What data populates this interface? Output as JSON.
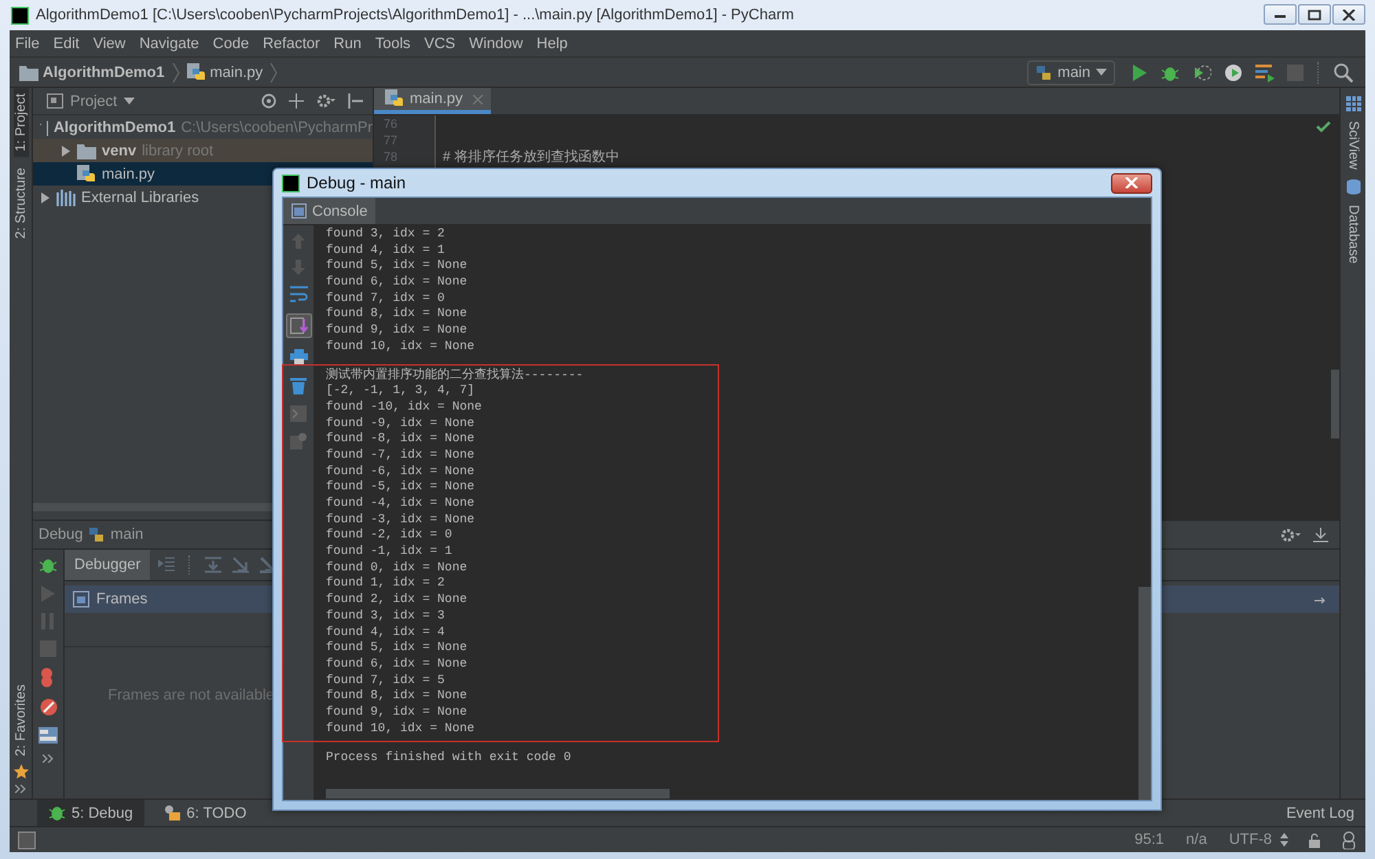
{
  "window": {
    "title": "AlgorithmDemo1 [C:\\Users\\cooben\\PycharmProjects\\AlgorithmDemo1] - ...\\main.py [AlgorithmDemo1] - PyCharm"
  },
  "menu": [
    "File",
    "Edit",
    "View",
    "Navigate",
    "Code",
    "Refactor",
    "Run",
    "Tools",
    "VCS",
    "Window",
    "Help"
  ],
  "breadcrumb": [
    "AlgorithmDemo1",
    "main.py"
  ],
  "run_config": "main",
  "left_strip": [
    {
      "label": "1: Project",
      "selected": true
    },
    {
      "label": "2: Structure",
      "selected": false
    }
  ],
  "favorites": "2: Favorites",
  "project": {
    "title": "Project",
    "tree": [
      {
        "name": "AlgorithmDemo1",
        "hint": "C:\\Users\\cooben\\PycharmPr",
        "kind": "folder",
        "expanded": true,
        "selected": false,
        "children": [
          {
            "name": "venv",
            "hint": "library root",
            "kind": "library-folder",
            "expanded": false,
            "selected": false
          },
          {
            "name": "main.py",
            "kind": "file",
            "selected": true
          }
        ]
      },
      {
        "name": "External Libraries",
        "kind": "library",
        "expanded": false,
        "selected": false
      }
    ]
  },
  "editor": {
    "tab": "main.py",
    "lines": [
      {
        "number": "76"
      },
      {
        "number": "77"
      },
      {
        "number": "78",
        "text": "# 将排序任务放到查找函数中"
      }
    ]
  },
  "right_strip": [
    "SciView",
    "Database"
  ],
  "debug_panel": {
    "title": "Debug",
    "config": "main",
    "tab": "Debugger",
    "frames": "Frames",
    "empty": "Frames are not available"
  },
  "bottom_tabs": [
    {
      "label": "5: Debug",
      "selected": true
    },
    {
      "label": "6: TODO",
      "selected": false
    }
  ],
  "event_log": "Event Log",
  "status": [
    "95:1",
    "n/a",
    "UTF-8"
  ],
  "debug_window": {
    "title": "Debug - main",
    "tab": "Console",
    "output": [
      "found 3, idx = 2",
      "found 4, idx = 1",
      "found 5, idx = None",
      "found 6, idx = None",
      "found 7, idx = 0",
      "found 8, idx = None",
      "found 9, idx = None",
      "found 10, idx = None"
    ],
    "highlighted": [
      "测试带内置排序功能的二分查找算法--------",
      "[-2, -1, 1, 3, 4, 7]",
      "found -10, idx = None",
      "found -9, idx = None",
      "found -8, idx = None",
      "found -7, idx = None",
      "found -6, idx = None",
      "found -5, idx = None",
      "found -4, idx = None",
      "found -3, idx = None",
      "found -2, idx = 0",
      "found -1, idx = 1",
      "found 0, idx = None",
      "found 1, idx = 2",
      "found 2, idx = None",
      "found 3, idx = 3",
      "found 4, idx = 4",
      "found 5, idx = None",
      "found 6, idx = None",
      "found 7, idx = 5",
      "found 8, idx = None",
      "found 9, idx = None",
      "found 10, idx = None"
    ],
    "footer": "Process finished with exit code 0"
  }
}
